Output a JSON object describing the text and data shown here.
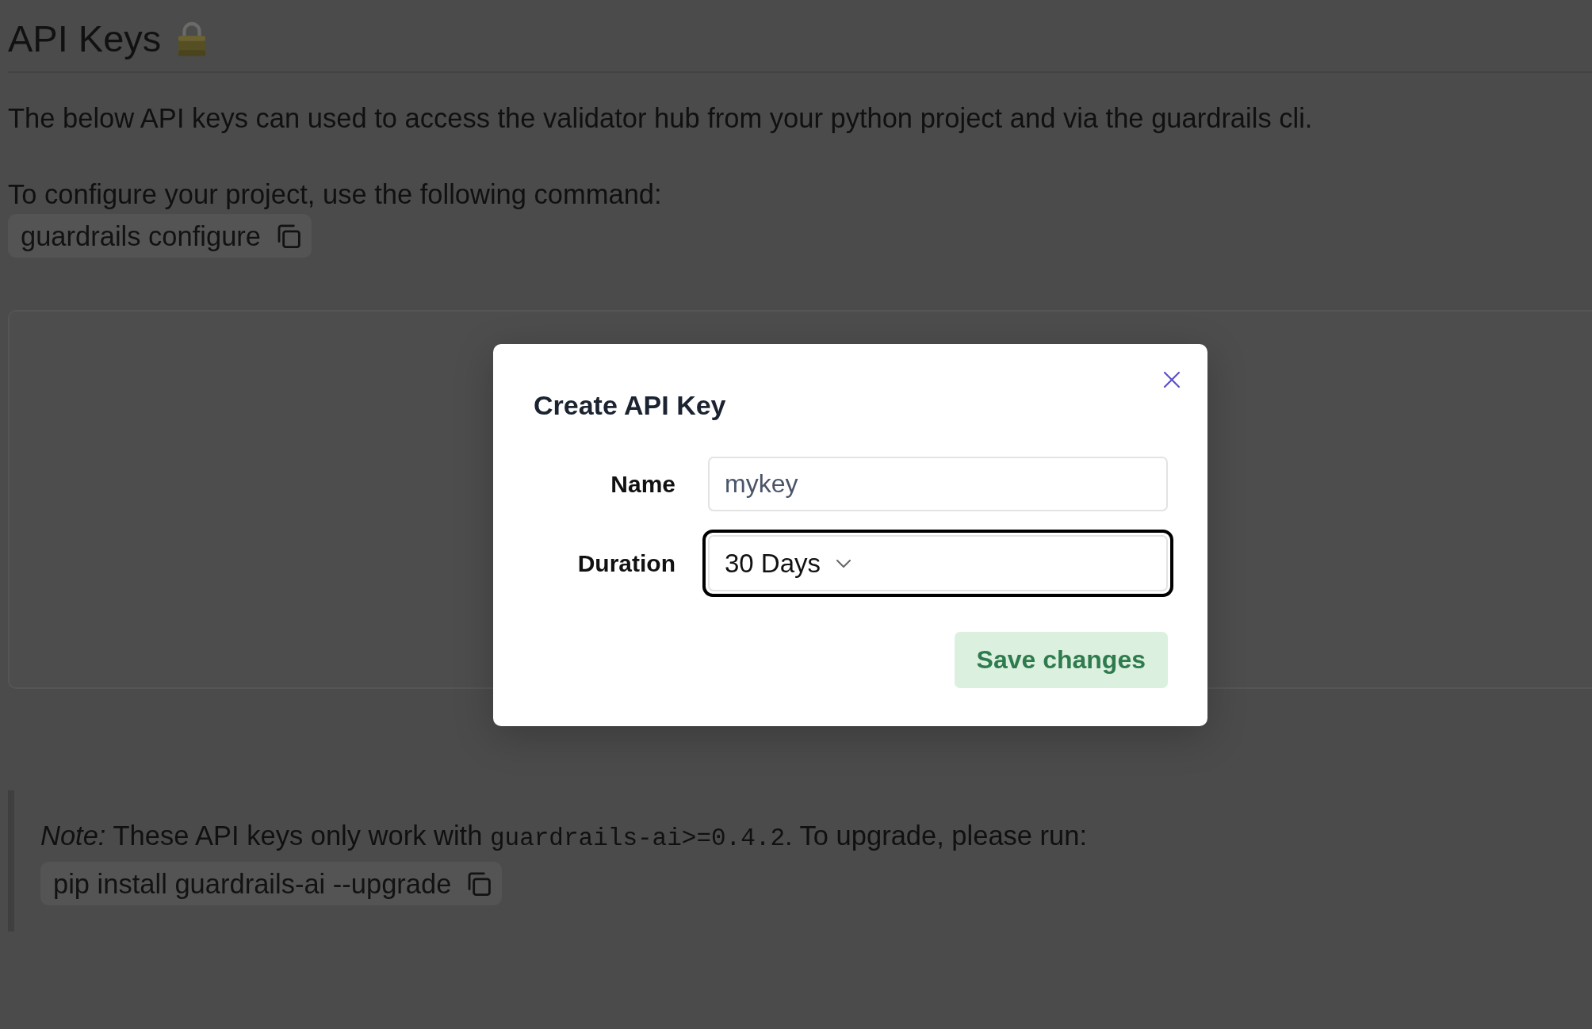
{
  "page": {
    "title": "API Keys",
    "description": "The below API keys can used to access the validator hub from your python project and via the guardrails cli.",
    "configure_label": "To configure your project, use the following command:",
    "configure_command": "guardrails configure"
  },
  "dialog": {
    "title": "Create API Key",
    "fields": [
      {
        "kind": "text",
        "label": "Name",
        "value": "mykey",
        "focused": false
      },
      {
        "kind": "select",
        "label": "Duration",
        "value": "30 Days",
        "focused": true
      }
    ],
    "button": "Save changes"
  },
  "note": {
    "segments": [
      {
        "kind": "text",
        "text": "*Note:* These API keys only work with "
      },
      {
        "kind": "code",
        "text": "guardrails-ai>=0.4.2"
      },
      {
        "kind": "text",
        "text": ". To upgrade, please run:"
      }
    ],
    "command": "pip install guardrails-ai --upgrade"
  }
}
